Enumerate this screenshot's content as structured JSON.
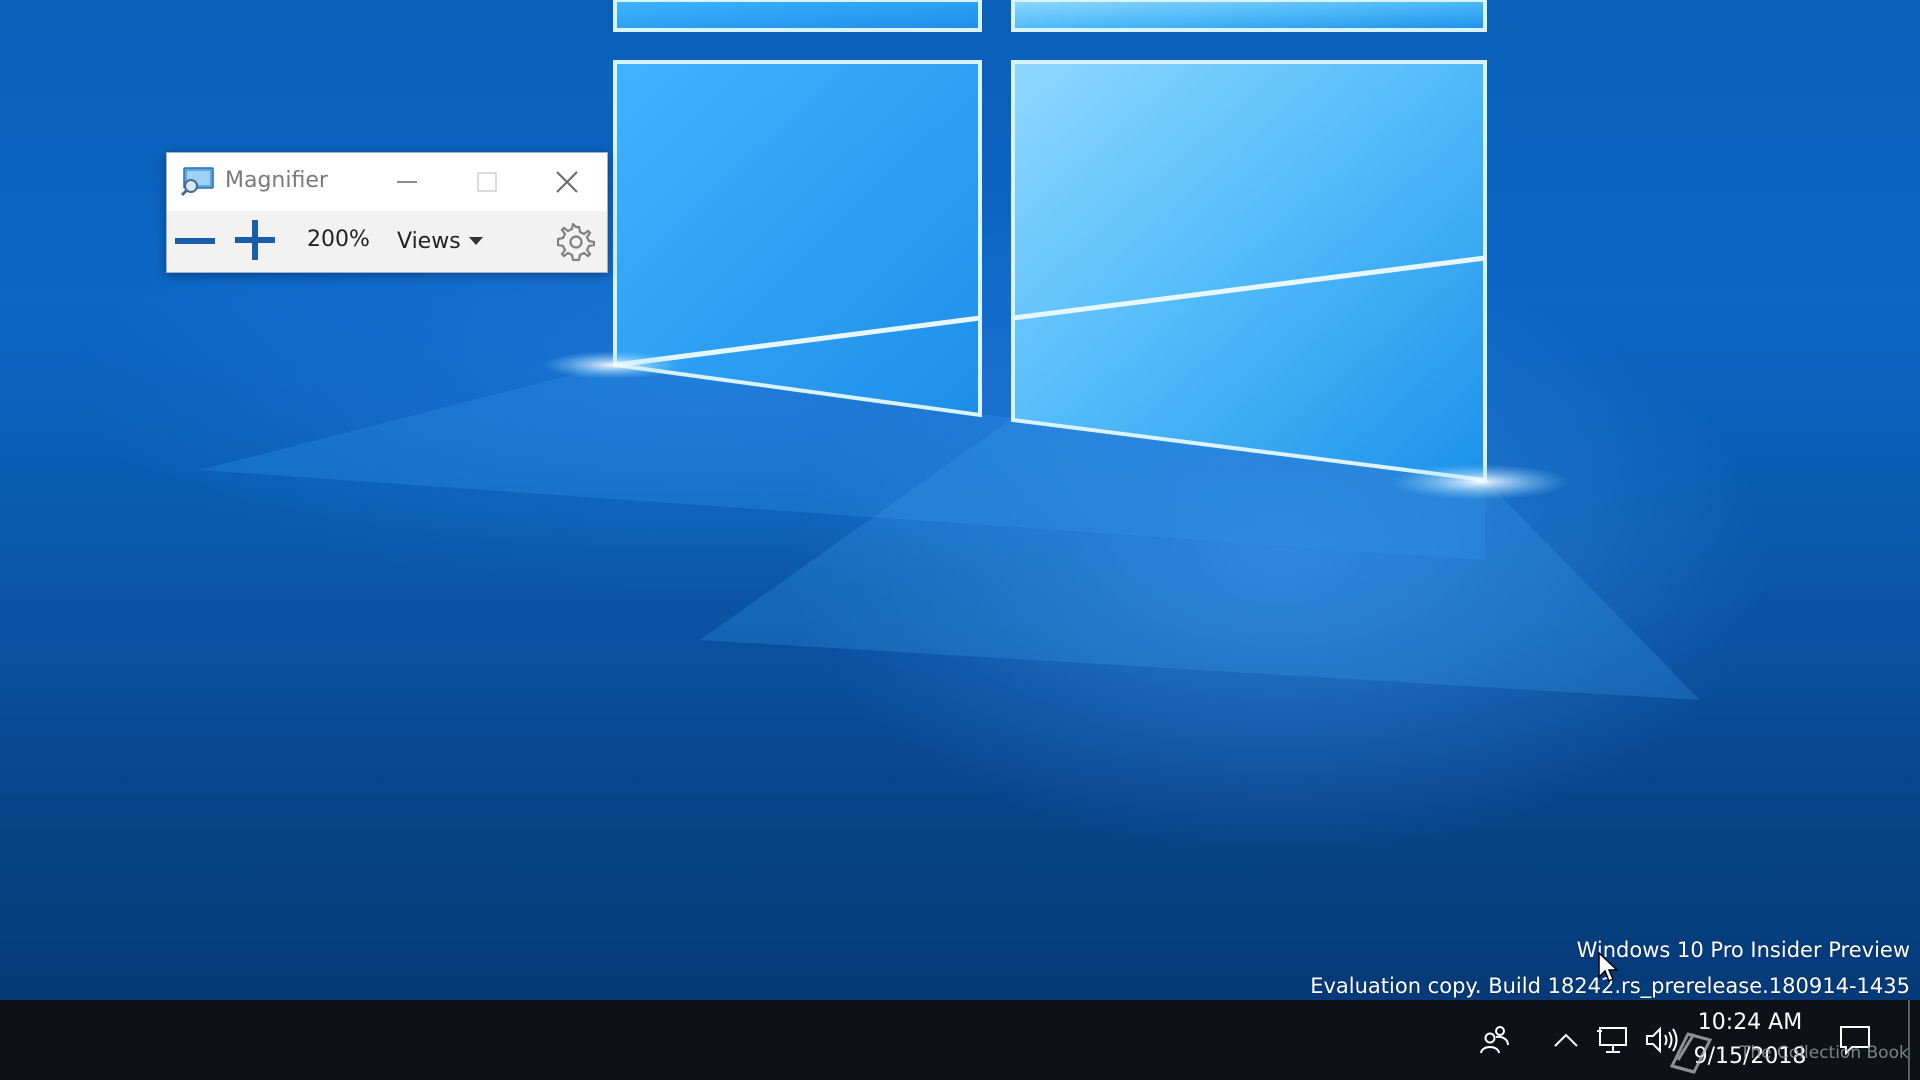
{
  "colors": {
    "desktop_blue": "#0b66c4",
    "taskbar_bg": "#0e1115",
    "magnifier_accent": "#1a5eab"
  },
  "magnifier": {
    "title": "Magnifier",
    "app_icon": "magnifier-icon",
    "zoom_level": "200%",
    "views_label": "Views",
    "icons": {
      "minimize": "minimize-icon",
      "maximize": "maximize-icon",
      "close": "close-icon",
      "zoom_out": "minus-icon",
      "zoom_in": "plus-icon",
      "views": "chevron-down-icon",
      "settings": "gear-icon"
    }
  },
  "watermark": {
    "line1": "Windows 10 Pro Insider Preview",
    "line2": "Evaluation copy. Build 18242.rs_prerelease.180914-1435"
  },
  "taskbar": {
    "tray_icons": [
      "people-icon",
      "chevron-up-icon",
      "network-icon",
      "volume-icon",
      "notification-icon"
    ],
    "time": "10:24 AM",
    "date": "9/15/2018"
  },
  "overlay": {
    "text": "The Collection Book"
  }
}
